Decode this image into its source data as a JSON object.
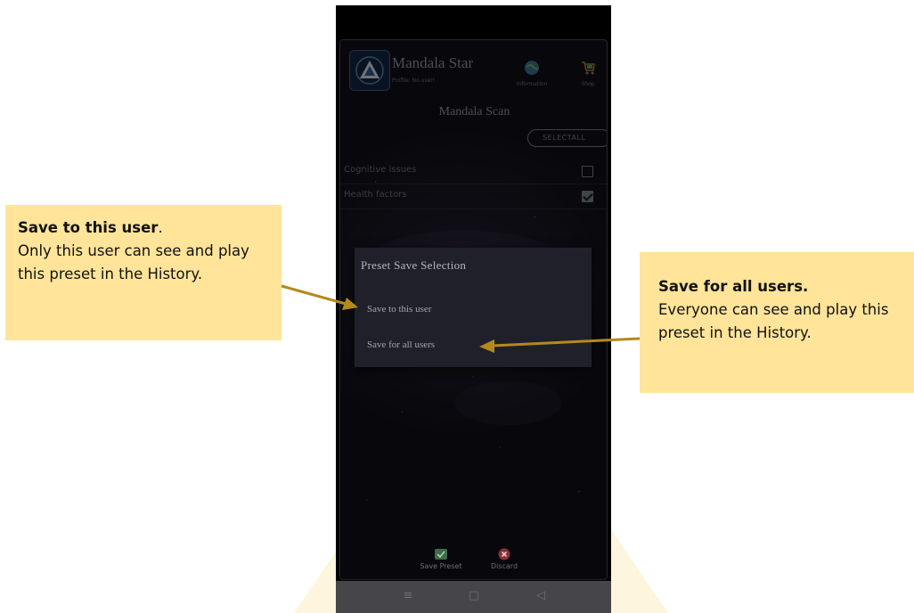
{
  "app": {
    "title": "Mandala Star",
    "profile": "Profile: No user!",
    "header_actions": [
      {
        "label": "Information",
        "icon": "globe-icon"
      },
      {
        "label": "Shop",
        "icon": "cart-icon"
      }
    ],
    "screen_title": "Mandala Scan",
    "select_all_label": "SELECTALL",
    "list": [
      {
        "label": "Cognitive issues",
        "checked": false
      },
      {
        "label": "Health factors",
        "checked": true
      }
    ],
    "bottom_actions": [
      {
        "label": "Save Preset",
        "icon": "save-preset-icon"
      },
      {
        "label": "Discard",
        "icon": "discard-icon"
      }
    ],
    "nav_bar": [
      "menu-icon",
      "home-icon",
      "back-icon"
    ]
  },
  "dialog": {
    "title": "Preset Save Selection",
    "options": [
      "Save to this user",
      "Save for all users"
    ]
  },
  "callouts": {
    "left": {
      "bold": "Save to this user",
      "bold_suffix": ".",
      "text": "Only this user can see and play this preset in the History."
    },
    "right": {
      "bold": "Save for all users.",
      "text": "Everyone can see and play this preset in the History."
    }
  },
  "colors": {
    "callout_bg": "#ffe49a",
    "arrow": "#b38a1a",
    "dialog_bg": "#20202a"
  }
}
